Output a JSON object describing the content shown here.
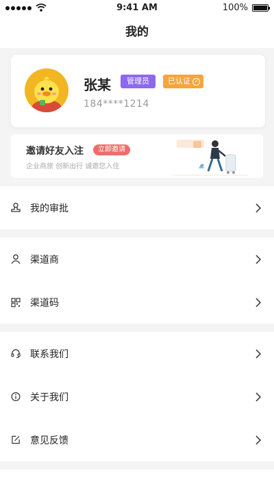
{
  "status_bar": {
    "time": "9:41 AM",
    "battery": "100%"
  },
  "header": {
    "title": "我的"
  },
  "profile": {
    "name": "张某",
    "role_badge": "管理员",
    "verified_badge": "已认证",
    "phone": "184****1214"
  },
  "invite": {
    "title": "邀请好友入注",
    "button": "立即邀请",
    "subtitle": "企业商旅  创新出行  诚邀您入住"
  },
  "menu": [
    {
      "label": "我的审批",
      "icon": "stamp-icon"
    },
    {
      "label": "渠道商",
      "icon": "user-icon"
    },
    {
      "label": "渠道码",
      "icon": "qr-code-icon"
    },
    {
      "label": "联系我们",
      "icon": "headset-icon"
    },
    {
      "label": "关于我们",
      "icon": "info-icon"
    },
    {
      "label": "意见反馈",
      "icon": "feedback-icon"
    }
  ],
  "colors": {
    "admin_badge": "#8c69f0",
    "verified_badge": "#f7a53a",
    "invite_button": "#ee6d6b",
    "background": "#f4f4f4"
  }
}
